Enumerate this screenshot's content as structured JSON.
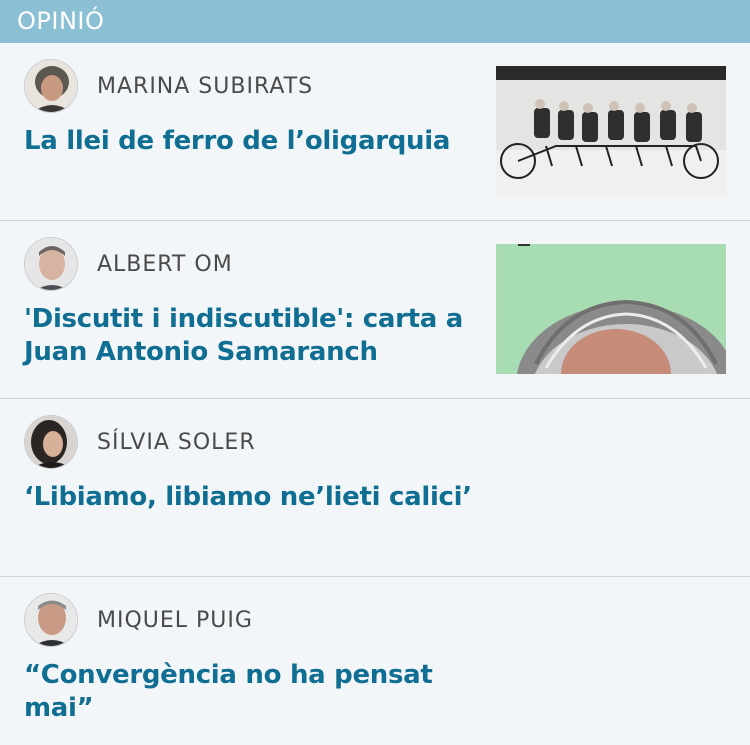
{
  "section": {
    "title": "OPINIÓ"
  },
  "articles": [
    {
      "author": "MARINA SUBIRATS",
      "headline": "La llei de ferro de l’oligarquia",
      "avatar_icon": "author-portrait",
      "thumbnail": "tandem-bicycle-photo"
    },
    {
      "author": "ALBERT OM",
      "headline": "'Discutit i indiscutible': carta a Juan Antonio Samaranch",
      "avatar_icon": "author-portrait",
      "thumbnail": "caricature-illustration"
    },
    {
      "author": "SÍLVIA SOLER",
      "headline": "‘Libiamo,  libiamo ne’lieti calici’",
      "avatar_icon": "author-portrait"
    },
    {
      "author": "MIQUEL PUIG",
      "headline": "“Convergència no ha pensat mai”",
      "avatar_icon": "author-portrait"
    }
  ],
  "colors": {
    "header_bg": "#8bbfd3",
    "headline": "#0f6e91",
    "author": "#4a4a4a",
    "page_bg": "#f2f6f9"
  }
}
